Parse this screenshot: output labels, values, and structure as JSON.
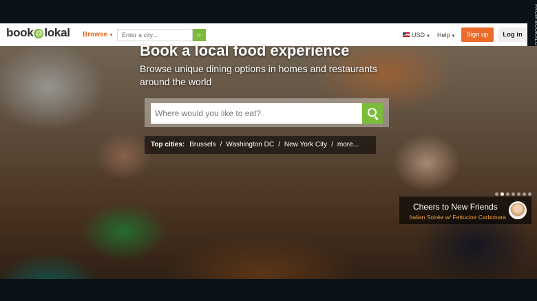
{
  "header": {
    "logo_pre": "book",
    "logo_at": "@",
    "logo_post": "lokal",
    "browse_label": "Browse",
    "city_placeholder": "Enter a city...",
    "currency": "USD",
    "help": "Help",
    "signup": "Sign up",
    "login": "Log in"
  },
  "credit": "FROM BOOKALOKAL.COM",
  "hero": {
    "title": "Book a local food experience",
    "subtitle": "Browse unique dining options in homes and restaurants around the world",
    "search_placeholder": "Where would you like to eat?",
    "top_cities_label": "Top cities:",
    "cities": [
      "Brussels",
      "Washington DC",
      "New York City",
      "more..."
    ]
  },
  "slider": {
    "dot_count": 7,
    "active_index": 1,
    "caption_title": "Cheers to New Friends",
    "caption_sub": "Italian Soirée w/ Fettucine Carbonara"
  },
  "colors": {
    "accent_green": "#7dbb3a",
    "accent_orange": "#ec6a2a"
  }
}
